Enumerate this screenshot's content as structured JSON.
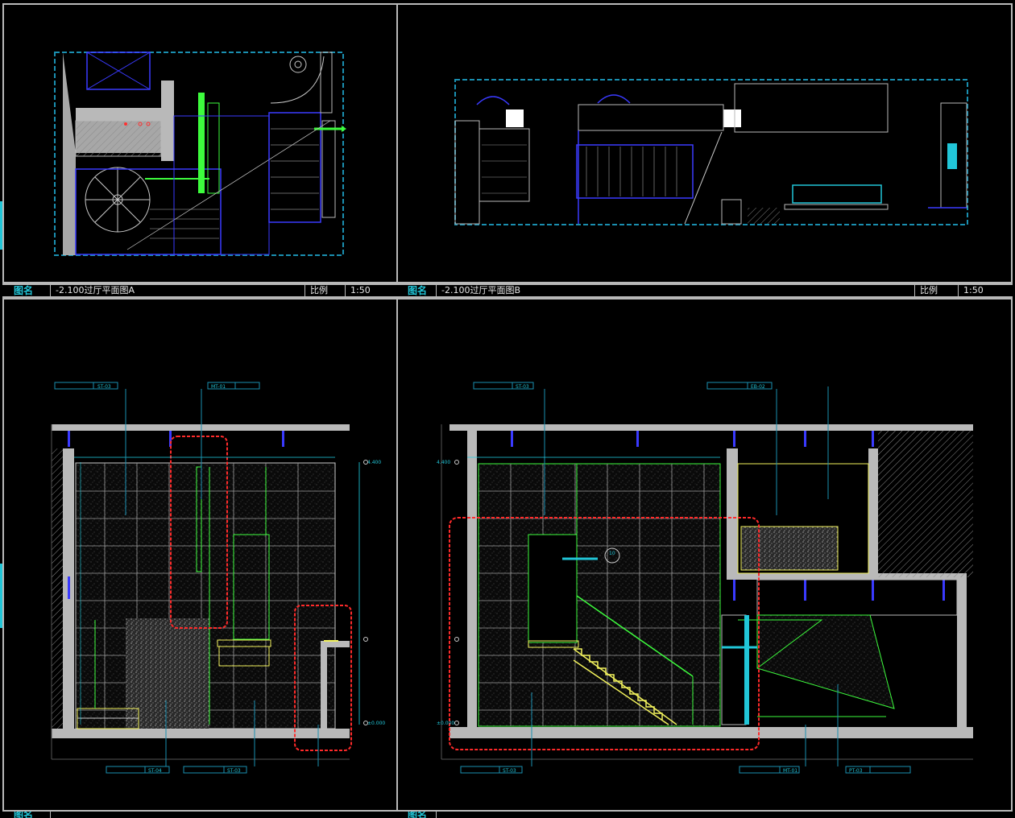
{
  "panels": [
    {
      "label": "图名",
      "title": "-2.100过厅平面图A",
      "scale_label": "比例",
      "scale": "1:50"
    },
    {
      "label": "图名",
      "title": "-2.100过厅平面图B",
      "scale_label": "比例",
      "scale": "1:50"
    },
    {
      "label": "图名",
      "title": "",
      "scale_label": "",
      "scale": ""
    },
    {
      "label": "图名",
      "title": "",
      "scale_label": "",
      "scale": ""
    }
  ],
  "elevation_a": {
    "tags": [
      "ST-03",
      "MT-01",
      "ST-04",
      "ST-03"
    ],
    "levels": [
      "4.400",
      "±0.000"
    ],
    "colors": {
      "wall": "#b9b9b9",
      "stone": "#f2f25c",
      "glass": "#3dfc3d",
      "cloud": "#ff2a2a",
      "dim": "#1fd2e6",
      "struct": "#3a3aff"
    }
  },
  "elevation_b": {
    "tags": [
      "ST-03",
      "EB-02",
      "ST-03",
      "MT-01",
      "PT-03"
    ],
    "levels": [
      "4.400",
      "±0.000"
    ],
    "callouts": [
      "10",
      "01"
    ]
  },
  "icons": {
    "north": "compass-icon",
    "stair": "spiral-stair-icon"
  }
}
